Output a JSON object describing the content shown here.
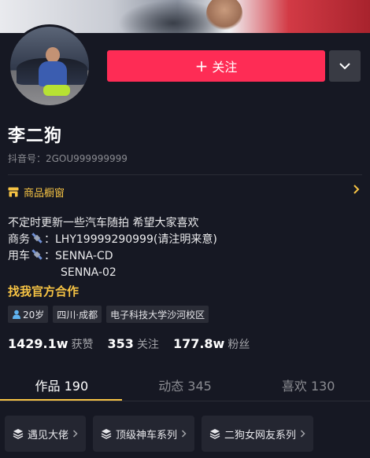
{
  "profile": {
    "name": "李二狗",
    "douyin_id": "抖音号：2GOU999999999",
    "follow_label": "关注",
    "follow_plus": "+"
  },
  "shop": {
    "label": "商品橱窗"
  },
  "bio": {
    "line1": "不定时更新一些汽车随拍 希望大家喜欢",
    "line2_prefix": "商务",
    "line2_text": "：LHY19999290999(请注明来意)",
    "line3_prefix": "用车",
    "line3_text": "：SENNA-CD",
    "line4_text": "SENNA-02"
  },
  "official_cooperation": "找我官方合作",
  "tags": {
    "age": "20岁",
    "location": "四川·成都",
    "school": "电子科技大学沙河校区"
  },
  "stats": {
    "likes_value": "1429.1w",
    "likes_label": "获赞",
    "following_value": "353",
    "following_label": "关注",
    "followers_value": "177.8w",
    "followers_label": "粉丝"
  },
  "tabs": {
    "works": "作品 190",
    "activity": "动态 345",
    "likes": "喜欢 130"
  },
  "collections": {
    "c1": "遇见大佬",
    "c2": "顶级神车系列",
    "c3": "二狗女网友系列"
  },
  "colors": {
    "background": "#161823",
    "follow_button": "#fe2c55",
    "accent_gold": "#f6c344"
  }
}
